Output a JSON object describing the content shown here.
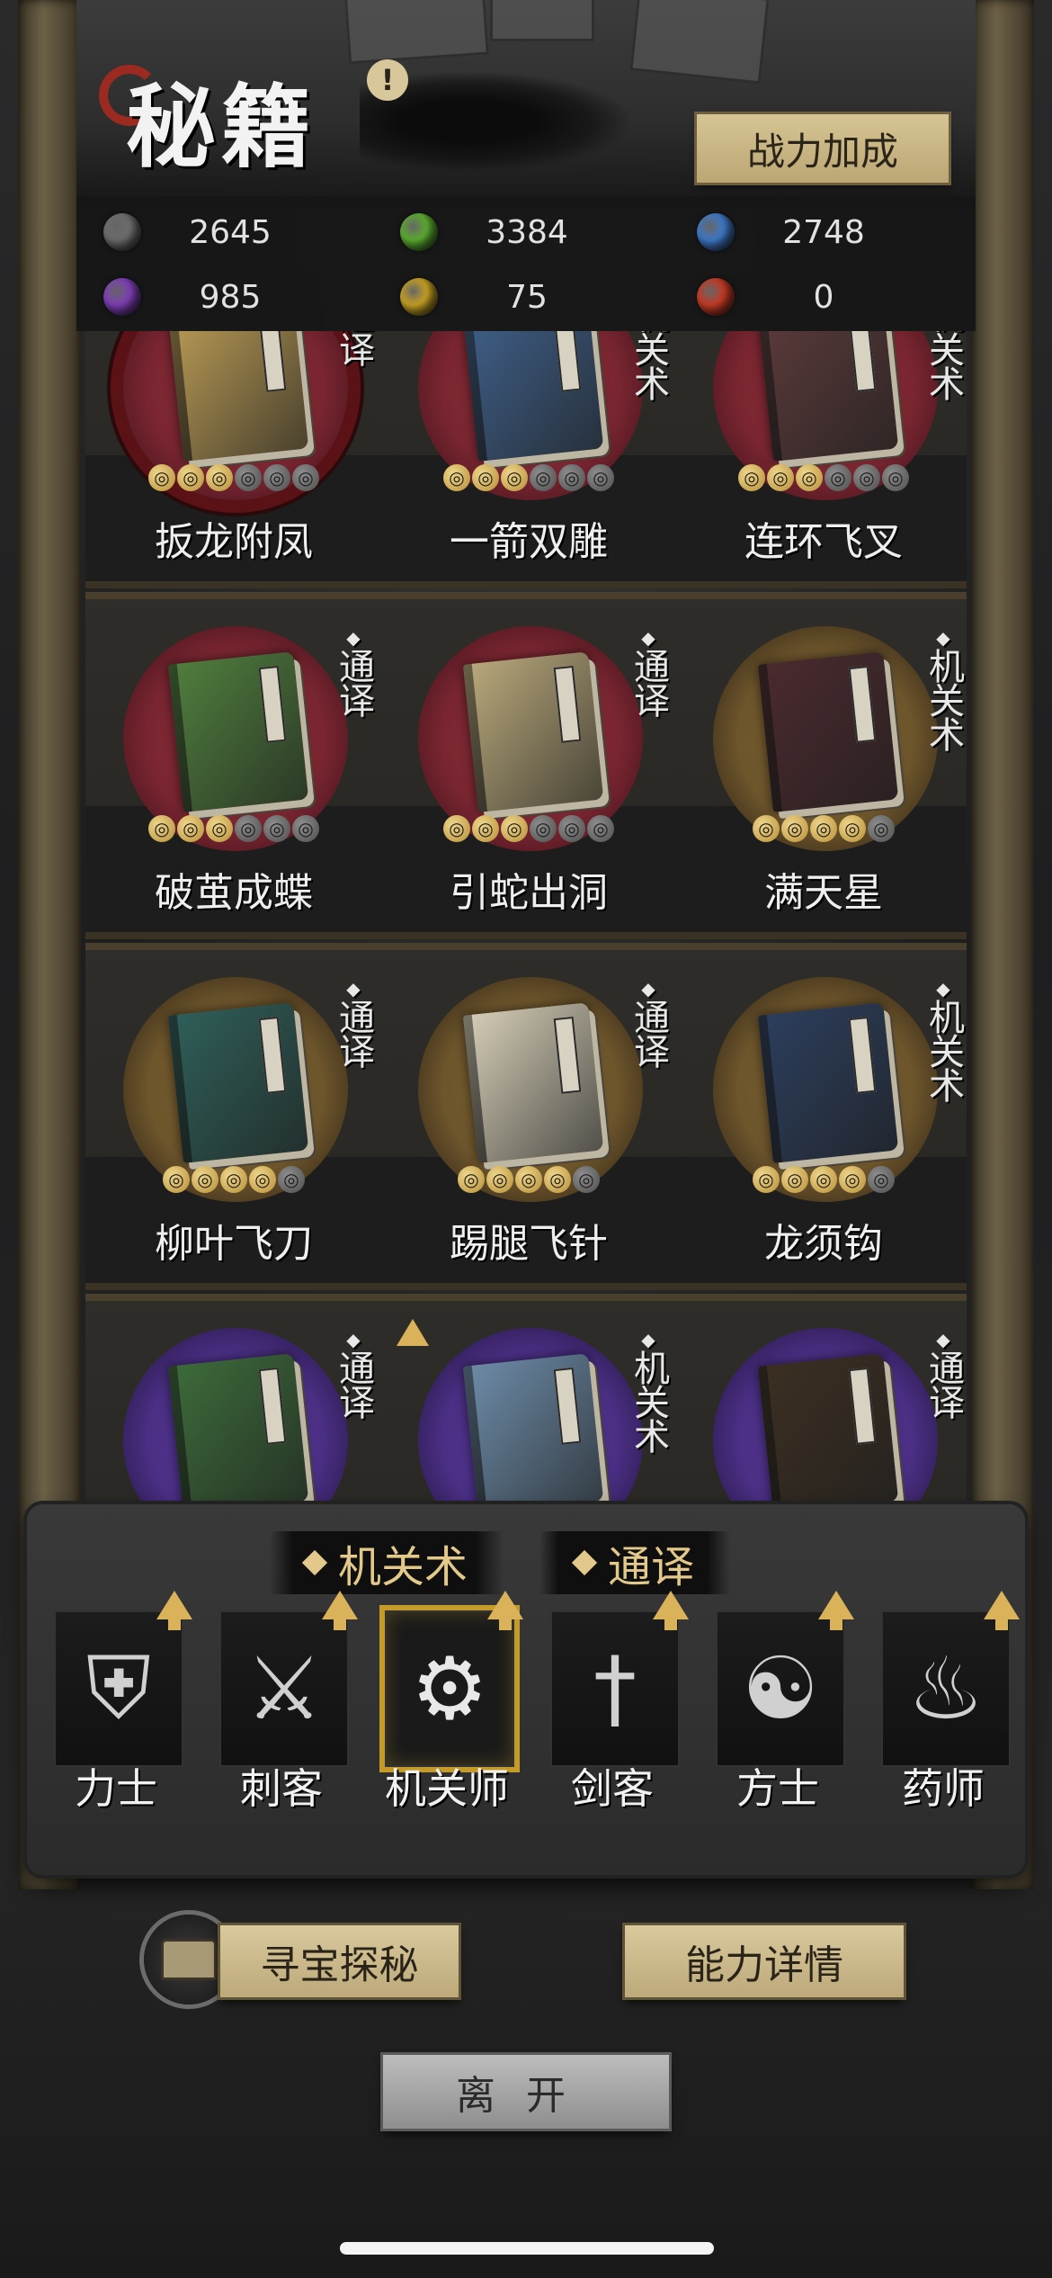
{
  "header": {
    "title": "秘籍",
    "info_icon": "!",
    "power_bonus_button": "战力加成"
  },
  "resources": [
    {
      "color": "#6e6e6e",
      "value": "2645"
    },
    {
      "color": "#5cae2f",
      "value": "3384"
    },
    {
      "color": "#3f7ac9",
      "value": "2748"
    },
    {
      "color": "#7f3fb8",
      "value": "985"
    },
    {
      "color": "#c9a322",
      "value": "75"
    },
    {
      "color": "#c73a25",
      "value": "0"
    }
  ],
  "manuals": {
    "rows": [
      [
        {
          "name": "扳龙附凤",
          "tag": "通译",
          "stars_on": 3,
          "stars_total": 6,
          "rarity": "red",
          "selected": true,
          "book_color": "#b89a55"
        },
        {
          "name": "一箭双雕",
          "tag": "机关术",
          "stars_on": 3,
          "stars_total": 6,
          "rarity": "red",
          "book_color": "#3f5f88"
        },
        {
          "name": "连环飞叉",
          "tag": "机关术",
          "stars_on": 3,
          "stars_total": 6,
          "rarity": "red",
          "book_color": "#5b3a3a"
        }
      ],
      [
        {
          "name": "破茧成蝶",
          "tag": "通译",
          "stars_on": 3,
          "stars_total": 6,
          "rarity": "red",
          "book_color": "#4f7d3d"
        },
        {
          "name": "引蛇出洞",
          "tag": "通译",
          "stars_on": 3,
          "stars_total": 6,
          "rarity": "red",
          "book_color": "#b7a77a"
        },
        {
          "name": "满天星",
          "tag": "机关术",
          "stars_on": 4,
          "stars_total": 5,
          "rarity": "gold",
          "book_color": "#4a2a2e"
        }
      ],
      [
        {
          "name": "柳叶飞刀",
          "tag": "通译",
          "stars_on": 4,
          "stars_total": 5,
          "rarity": "gold",
          "book_color": "#2f5e58"
        },
        {
          "name": "踢腿飞针",
          "tag": "通译",
          "stars_on": 4,
          "stars_total": 5,
          "rarity": "gold",
          "book_color": "#d2cbb5"
        },
        {
          "name": "龙须钩",
          "tag": "机关术",
          "stars_on": 4,
          "stars_total": 5,
          "rarity": "gold",
          "book_color": "#2c3e5c"
        }
      ],
      [
        {
          "name": "",
          "tag": "通译",
          "stars_on": 0,
          "stars_total": 0,
          "rarity": "purple",
          "book_color": "#3c6a3a"
        },
        {
          "name": "",
          "tag": "机关术",
          "stars_on": 0,
          "stars_total": 0,
          "rarity": "purple",
          "upgrade": true,
          "book_color": "#6c8aa6"
        },
        {
          "name": "",
          "tag": "通译",
          "stars_on": 0,
          "stars_total": 0,
          "rarity": "purple",
          "book_color": "#3b2f22"
        }
      ]
    ]
  },
  "filters": [
    {
      "label": "机关术",
      "icon": "diamond-icon"
    },
    {
      "label": "通译",
      "icon": "diamond-icon"
    }
  ],
  "classes": [
    {
      "label": "力士",
      "icon": "shield-icon",
      "glyph": "⛨",
      "active": false
    },
    {
      "label": "刺客",
      "icon": "blades-icon",
      "glyph": "⚔",
      "active": false
    },
    {
      "label": "机关师",
      "icon": "gears-icon",
      "glyph": "⚙",
      "active": true
    },
    {
      "label": "剑客",
      "icon": "sword-icon",
      "glyph": "†",
      "active": false
    },
    {
      "label": "方士",
      "icon": "yin-yang-icon",
      "glyph": "☯",
      "active": false
    },
    {
      "label": "药师",
      "icon": "gourd-icon",
      "glyph": "♨",
      "active": false
    }
  ],
  "buttons": {
    "treasure": "寻宝探秘",
    "ability_details": "能力详情",
    "leave": "离开"
  }
}
